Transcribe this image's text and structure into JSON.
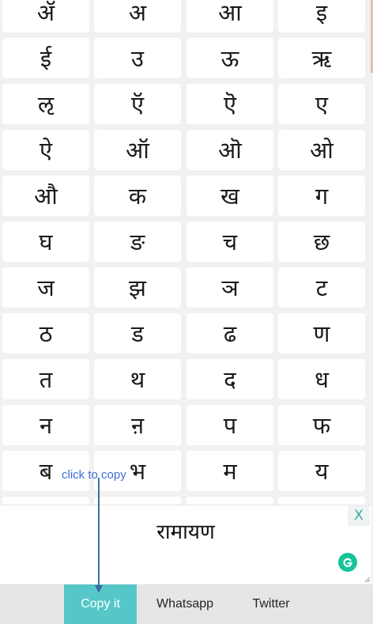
{
  "keyboard": {
    "rows": [
      [
        "ॲ",
        "अ",
        "आ",
        "इ"
      ],
      [
        "ई",
        "उ",
        "ऊ",
        "ऋ"
      ],
      [
        "ऌ",
        "ऍ",
        "ऎ",
        "ए"
      ],
      [
        "ऐ",
        "ऑ",
        "ऒ",
        "ओ"
      ],
      [
        "औ",
        "क",
        "ख",
        "ग"
      ],
      [
        "घ",
        "ङ",
        "च",
        "छ"
      ],
      [
        "ज",
        "झ",
        "ञ",
        "ट"
      ],
      [
        "ठ",
        "ड",
        "ढ",
        "ण"
      ],
      [
        "त",
        "थ",
        "द",
        "ध"
      ],
      [
        "न",
        "ऩ",
        "प",
        "फ"
      ],
      [
        "ब",
        "भ",
        "म",
        "य"
      ],
      [
        "",
        "",
        "",
        ""
      ]
    ]
  },
  "editor": {
    "text": "रामायण",
    "close_label": "X",
    "grammarly_icon": "grammarly-icon"
  },
  "tooltip": {
    "label": "click to copy"
  },
  "actions": {
    "copy_label": "Copy it",
    "whatsapp_label": "Whatsapp",
    "twitter_label": "Twitter"
  },
  "colors": {
    "copy_button": "#56c7c8",
    "tooltip": "#3d6fd6",
    "grammarly": "#15c39a",
    "close_x": "#3aa6a0"
  }
}
